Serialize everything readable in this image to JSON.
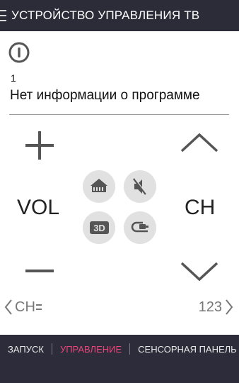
{
  "header": {
    "title": "УСТРОЙСТВО УПРАВЛЕНИЯ ТВ",
    "menu_icon": "hamburger-menu-icon"
  },
  "power": {
    "icon": "power-icon"
  },
  "program": {
    "channel_number": "1",
    "info": "Нет информации о программе"
  },
  "volume": {
    "label": "VOL",
    "up_icon": "plus-icon",
    "down_icon": "minus-icon"
  },
  "channel": {
    "label": "CH",
    "up_icon": "chevron-up-icon",
    "down_icon": "chevron-down-icon"
  },
  "quick_buttons": [
    {
      "icon": "home-icon"
    },
    {
      "icon": "mute-icon"
    },
    {
      "icon": "3d-icon",
      "text": "3D"
    },
    {
      "icon": "input-source-icon"
    }
  ],
  "nav": {
    "left_label": "CH",
    "right_label": "123"
  },
  "tabs": [
    {
      "label": "ЗАПУСК",
      "active": false
    },
    {
      "label": "УПРАВЛЕНИЕ",
      "active": true
    },
    {
      "label": "СЕНСОРНАЯ ПАНЕЛЬ",
      "active": false
    }
  ],
  "colors": {
    "header_bg": "#2c2c38",
    "accent": "#e8457a",
    "button_bg": "#e1e1e1",
    "icon": "#555555"
  }
}
